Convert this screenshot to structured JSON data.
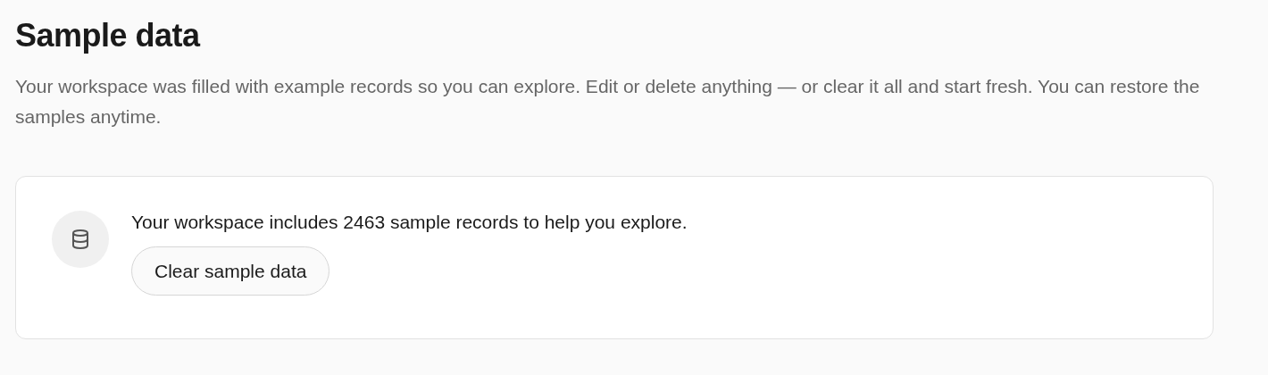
{
  "title": "Sample data",
  "description": "Your workspace was filled with example records so you can explore. Edit or delete anything — or clear it all and start fresh. You can restore the samples anytime.",
  "card": {
    "message": "Your workspace includes 2463 sample records to help you explore.",
    "button": "Clear sample data"
  }
}
